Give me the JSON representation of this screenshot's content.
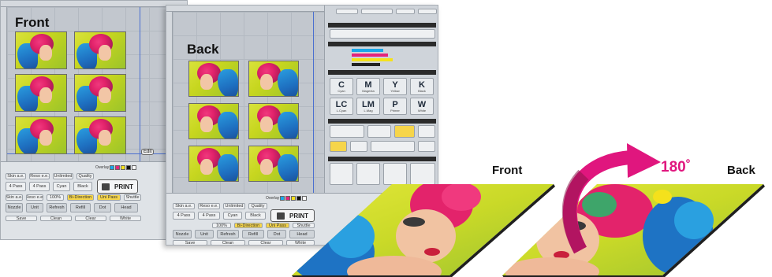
{
  "front_window": {
    "label": "Front",
    "corner_tag": "Edit",
    "bottom_panel": {
      "print_label": "PRINT",
      "swatch_label": "Overlay",
      "cells": [
        "Skin a.e.",
        "Reso e.e.",
        "Unlimited",
        "Quality",
        "Save",
        "4 Pass",
        "4 Pass",
        "Cyan",
        "Black",
        "100%",
        "Bi-Direction",
        "Uni Pass",
        "Shuttle",
        "Nozzle",
        "Unit",
        "Dot",
        "Refresh",
        "Refill",
        "White",
        "Head",
        "Clean",
        "Clear"
      ]
    }
  },
  "back_window": {
    "label": "Back",
    "bottom_panel": {
      "print_label": "PRINT",
      "swatch_label": "Overlay",
      "cells": [
        "Skin a.e.",
        "Reso e.e.",
        "Unlimited",
        "Quality",
        "Save",
        "4 Pass",
        "4 Pass",
        "Cyan",
        "Black",
        "100%",
        "Bi-Direction",
        "Uni Pass",
        "Shuttle",
        "Nozzle",
        "Unit",
        "Dot",
        "Refresh",
        "Refill",
        "White",
        "Head",
        "Clean",
        "Clear"
      ]
    },
    "right_panel": {
      "inks": [
        {
          "letter": "C",
          "name": "Cyan"
        },
        {
          "letter": "M",
          "name": "Magenta"
        },
        {
          "letter": "Y",
          "name": "Yellow"
        },
        {
          "letter": "K",
          "name": "Black"
        },
        {
          "letter": "LC",
          "name": "L.Cyan"
        },
        {
          "letter": "LM",
          "name": "L.Mag"
        },
        {
          "letter": "P",
          "name": "Primer"
        },
        {
          "letter": "W",
          "name": "White"
        }
      ]
    }
  },
  "demo": {
    "front_label": "Front",
    "back_label": "Back",
    "rotation_label": "180˚"
  },
  "colors": {
    "accent_arrow": "#e0167e",
    "canvas_bg": "#c2c7ce",
    "photo_bg": "#d9e23b"
  }
}
